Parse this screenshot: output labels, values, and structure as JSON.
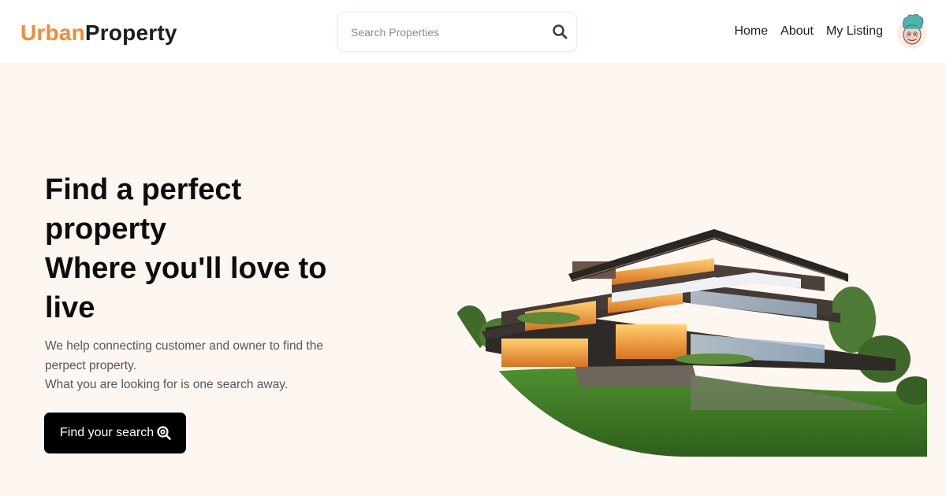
{
  "header": {
    "logo": {
      "part1": "Urban",
      "part2": "Property"
    },
    "search": {
      "placeholder": "Search Properties",
      "value": "",
      "icon": "search-icon"
    },
    "nav": [
      {
        "label": "Home"
      },
      {
        "label": "About"
      },
      {
        "label": "My Listing"
      }
    ],
    "avatar": "user-avatar-cartoon"
  },
  "hero": {
    "title_lines": [
      "Find a perfect",
      "property",
      "Where you'll love to",
      "live"
    ],
    "description_lines": [
      "We help connecting customer and owner to find the",
      "perpect property.",
      "What you are looking for is one search away."
    ],
    "cta": {
      "label": "Find your search",
      "icon": "zoom-search-icon"
    },
    "image": "modern-house-on-lawn"
  },
  "colors": {
    "accent": "#ef8b3a",
    "logo_dark": "#1d1d1d",
    "hero_bg": "#fdf6f1",
    "header_bg": "#ffffff",
    "button_bg": "#000000",
    "body_text": "#55585d"
  }
}
